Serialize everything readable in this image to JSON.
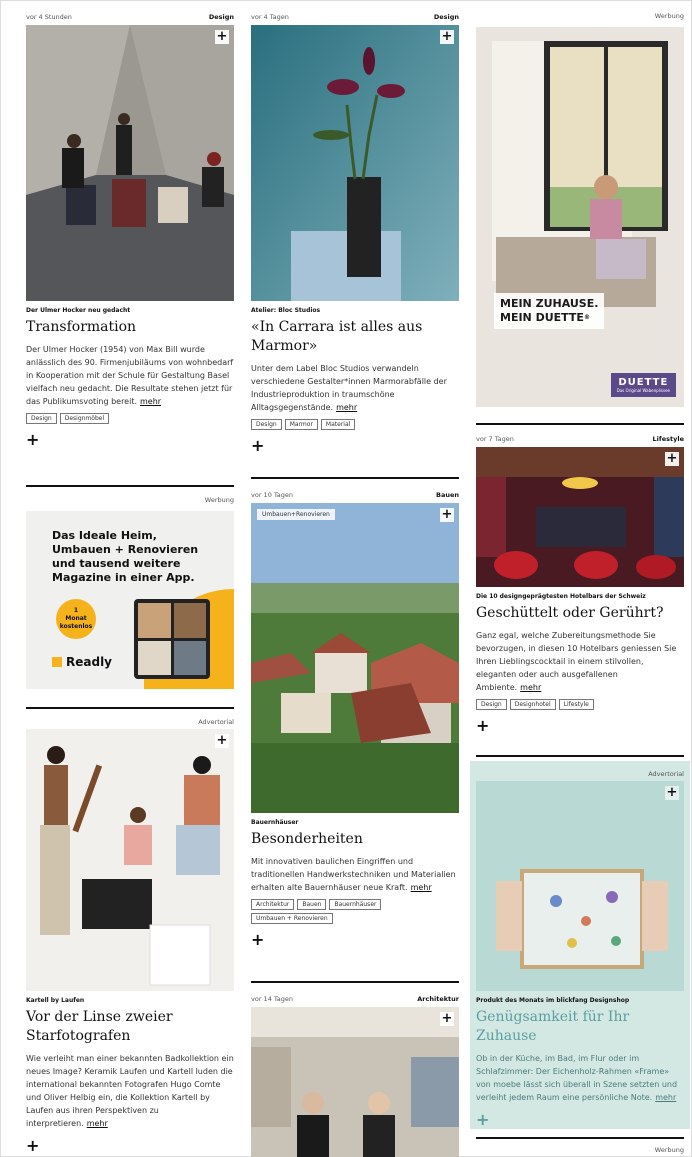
{
  "col1": {
    "card1": {
      "time": "vor 4 Stunden",
      "category": "Design",
      "kicker": "Der Ulmer Hocker neu gedacht",
      "title": "Transformation",
      "excerpt": "Der Ulmer Hocker (1954) von Max Bill wurde anlässlich des 90. Firmenjubiläums von wohnbedarf in Kooperation mit der Schule für Gestaltung Basel vielfach neu gedacht. Die Resultate stehen jetzt für das Publikumsvoting bereit.",
      "more": "mehr",
      "tags": [
        "Design",
        "Designmöbel"
      ]
    },
    "ad1": {
      "label": "Werbung",
      "headline_1": "Das Ideale Heim,",
      "headline_2": "Umbauen + Renovieren",
      "headline_3": "und tausend weitere",
      "headline_4": "Magazine in einer App.",
      "badge_1": "1",
      "badge_2": "Monat",
      "badge_3": "kostenlos",
      "brand": "Readly"
    },
    "card2": {
      "label": "Advertorial",
      "kicker": "Kartell by Laufen",
      "title": "Vor der Linse zweier Starfotografen",
      "excerpt": "Wie verleiht man einer bekannten Badkollektion ein neues Image? Keramik Laufen und Kartell luden die international bekannten Fotografen Hugo Comte und Oliver Helbig ein, die Kollektion Kartell by Laufen aus ihren Perspektiven zu interpretieren.",
      "more": "mehr"
    }
  },
  "col2": {
    "card1": {
      "time": "vor 4 Tagen",
      "category": "Design",
      "kicker": "Atelier: Bloc Studios",
      "title": "«In Carrara ist alles aus Marmor»",
      "excerpt": "Unter dem Label Bloc Studios verwandeln verschiedene Gestalter*innen Marmorabfälle der Industrieproduktion in traumschöne Alltagsgegenstände.",
      "more": "mehr",
      "tags": [
        "Design",
        "Marmor",
        "Material"
      ]
    },
    "card2": {
      "time": "vor 10 Tagen",
      "category": "Bauen",
      "pill": "Umbauen+Renovieren",
      "kicker": "Bauernhäuser",
      "title": "Besonderheiten",
      "excerpt": "Mit innovativen baulichen Eingriffen und traditionellen Handwerkstechniken und Materialien erhalten alte Bauernhäuser neue Kraft.",
      "more": "mehr",
      "tags": [
        "Architektur",
        "Bauen",
        "Bauernhäuser",
        "Umbauen + Renovieren"
      ]
    },
    "card3": {
      "time": "vor 14 Tagen",
      "category": "Architektur"
    }
  },
  "col3": {
    "ad1": {
      "label": "Werbung",
      "slogan_1": "MEIN ZUHAUSE.",
      "slogan_2": "MEIN DUETTE",
      "reg": "®",
      "brand": "DUETTE",
      "brand_sub": "Das Original Wabenplissee"
    },
    "card1": {
      "time": "vor 7 Tagen",
      "category": "Lifestyle",
      "kicker": "Die 10 designgeprägtesten Hotelbars der Schweiz",
      "title": "Geschüttelt oder Gerührt?",
      "excerpt": "Ganz egal, welche Zubereitungsmethode Sie bevorzugen, in diesen 10 Hotelbars geniessen Sie Ihren Lieblingscocktail in einem stilvollen, eleganten oder auch ausgefallenen Ambiente.",
      "more": "mehr",
      "tags": [
        "Design",
        "Designhotel",
        "Lifestyle"
      ]
    },
    "card2": {
      "label": "Advertorial",
      "kicker": "Produkt des Monats im blickfang Designshop",
      "title": "Genügsamkeit für Ihr Zuhause",
      "excerpt": "Ob in der Küche, im Bad, im Flur oder im Schlafzimmer: Der Eichenholz-Rahmen «Frame» von moebe lässt sich überall in Szene setzten und verleiht jedem Raum eine persönliche Note.",
      "more": "mehr"
    },
    "footer_label": "Werbung"
  },
  "plus": "+",
  "colors": {
    "accent_teal": "#5b9ea0",
    "advertorial_bg": "#d4e8e3",
    "readly_yellow": "#f5b21b"
  }
}
